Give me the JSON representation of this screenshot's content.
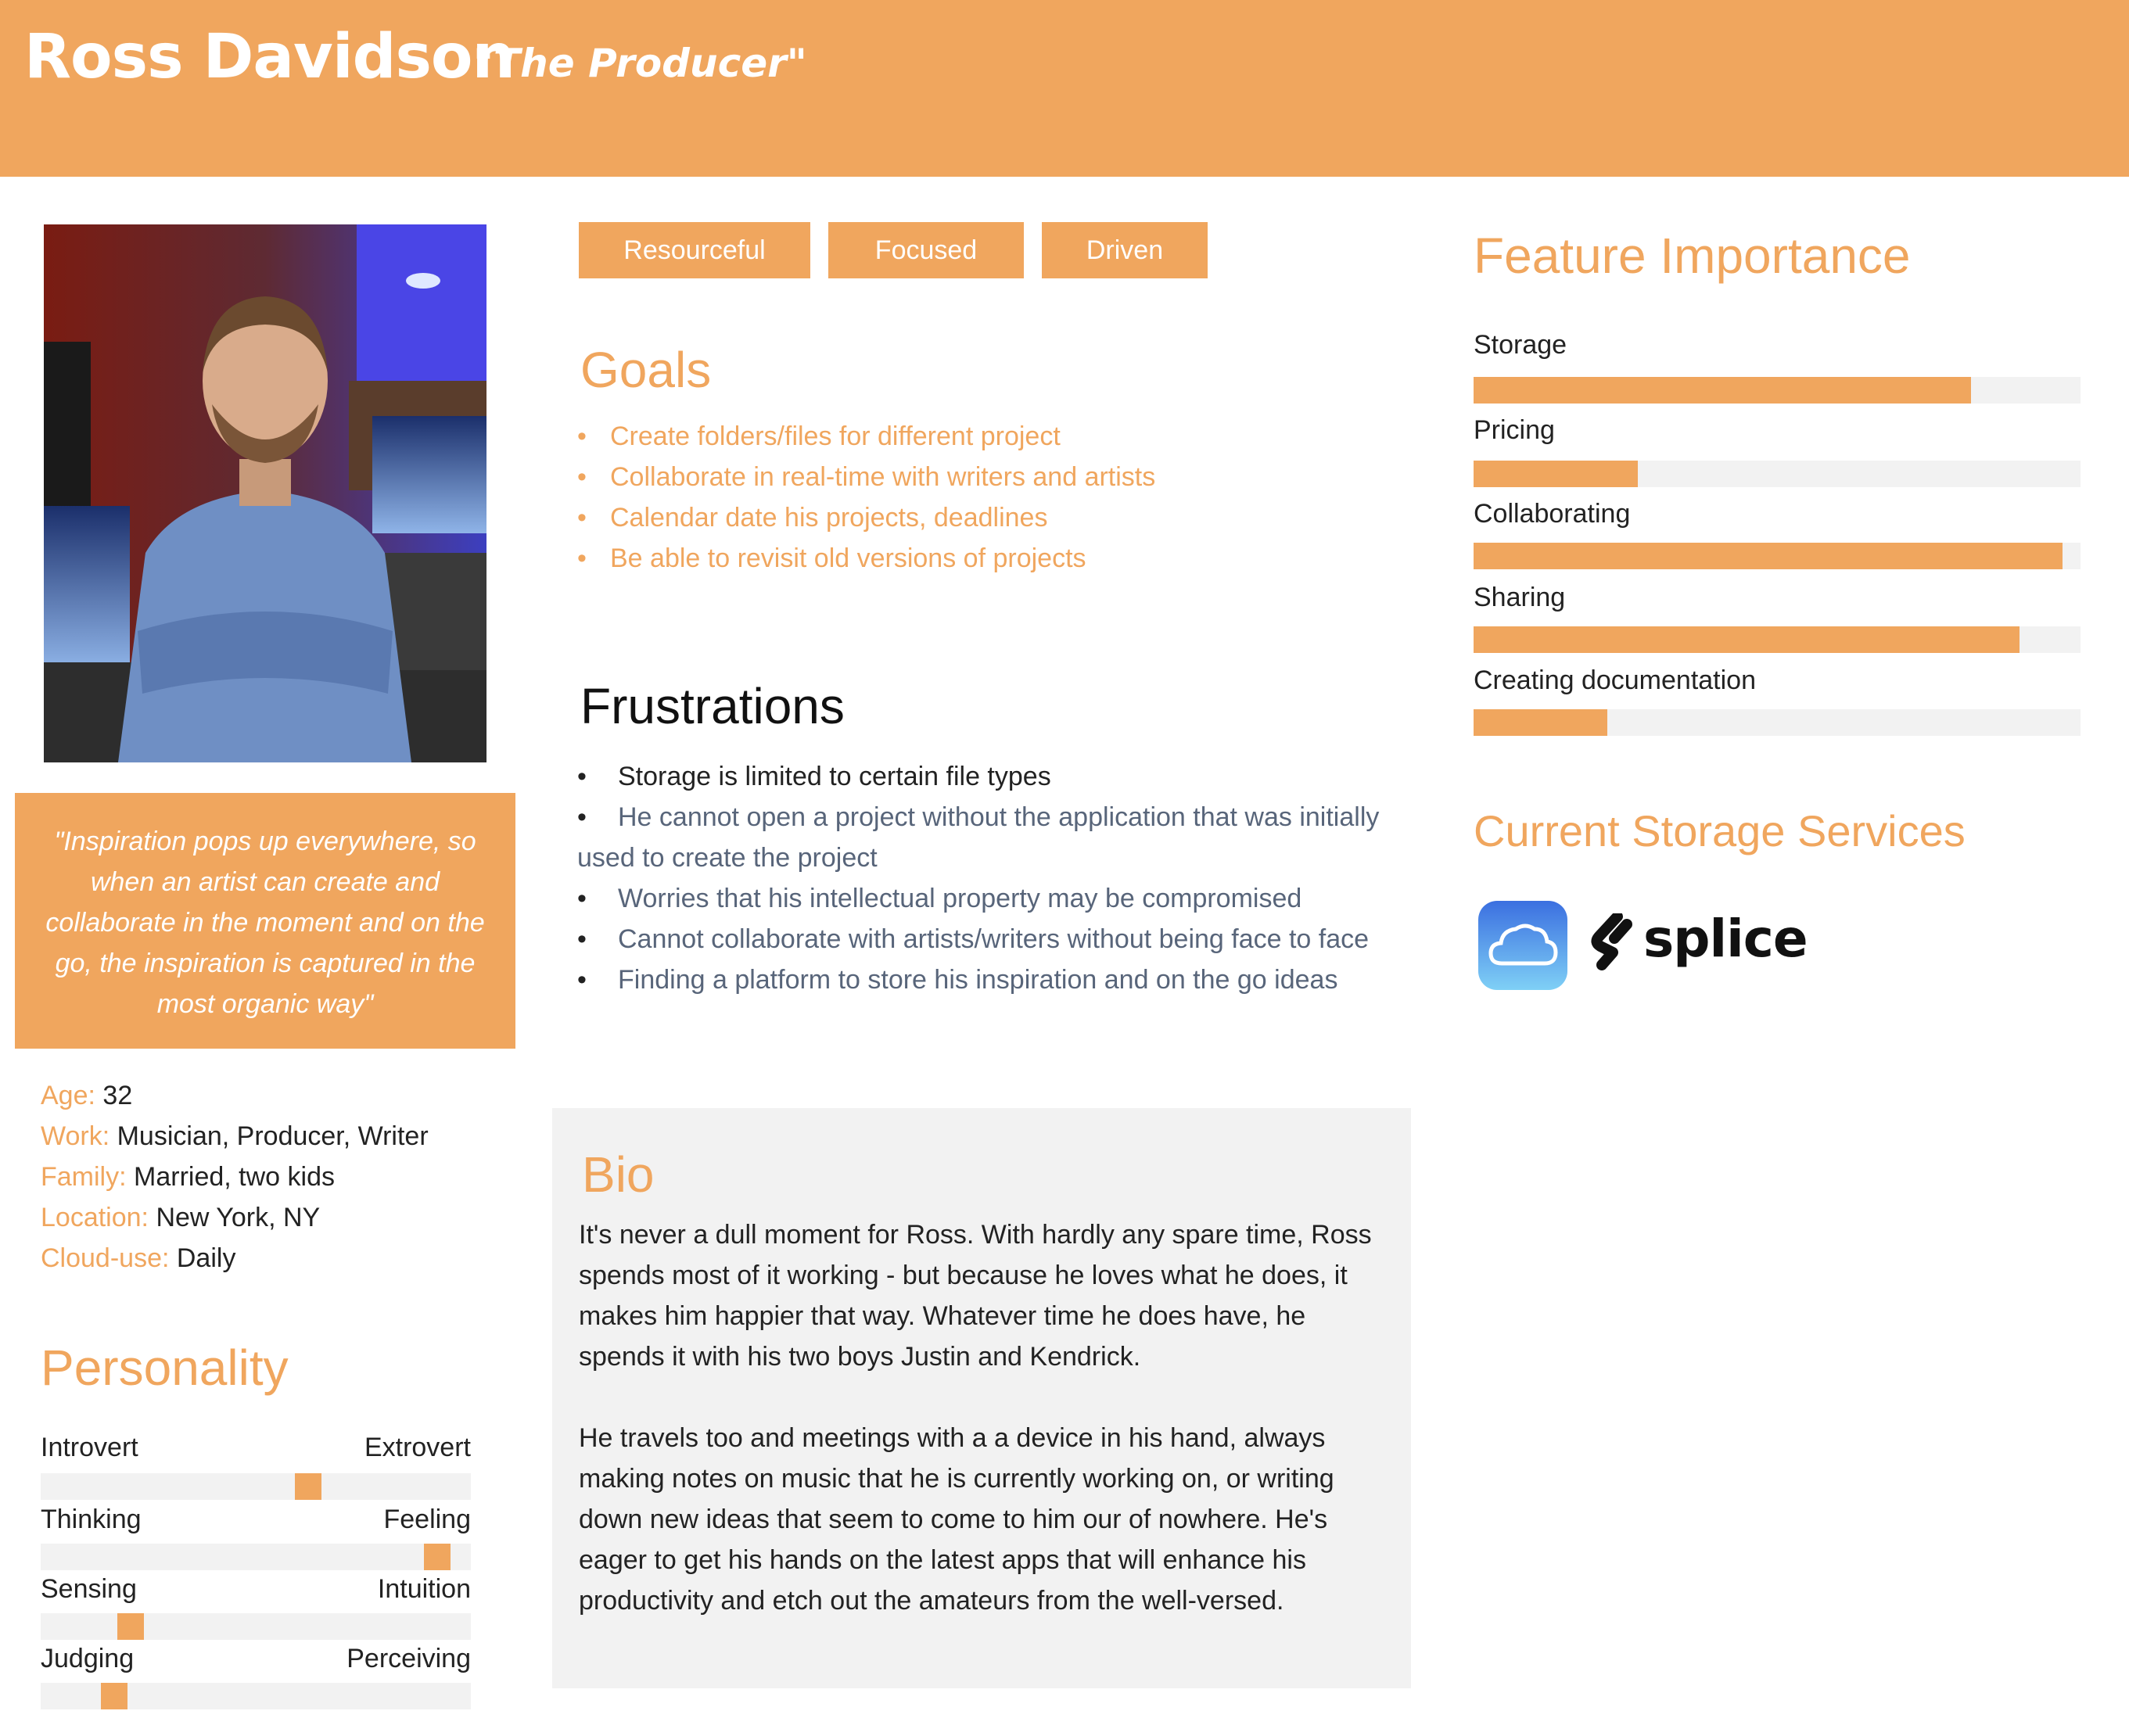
{
  "header": {
    "name": "Ross Davidson",
    "nickname": "\"The Producer\""
  },
  "quote": "\"Inspiration pops up everywhere, so when an artist can create and collaborate in the moment and on the go, the inspiration is captured in the most organic way\"",
  "facts": [
    {
      "label": "Age:",
      "value": "32"
    },
    {
      "label": "Work:",
      "value": "Musician, Producer, Writer"
    },
    {
      "label": "Family:",
      "value": "Married, two kids"
    },
    {
      "label": "Location:",
      "value": "New York, NY"
    },
    {
      "label": "Cloud-use:",
      "value": "Daily"
    }
  ],
  "personality": {
    "title": "Personality",
    "traits": [
      {
        "left": "Introvert",
        "right": "Extrovert",
        "level": 0.63
      },
      {
        "left": "Thinking",
        "right": "Feeling",
        "level": 0.95
      },
      {
        "left": "Sensing",
        "right": "Intuition",
        "level": 0.19
      },
      {
        "left": "Judging",
        "right": "Perceiving",
        "level": 0.15
      }
    ]
  },
  "tags": [
    "Resourceful",
    "Focused",
    "Driven"
  ],
  "goals": {
    "title": "Goals",
    "items": [
      "Create folders/files for different project",
      "Collaborate in real-time with writers and artists",
      "Calendar date his projects, deadlines",
      "Be able to revisit old versions of projects"
    ]
  },
  "frustrations": {
    "title": "Frustrations",
    "items": [
      "Storage is limited to certain file types",
      "He cannot open a project without the application that was initially used to create the project",
      "Worries that his intellectual property may be compromised",
      "Cannot collaborate with artists/writers without being face to face",
      "Finding a platform to store his inspiration and on the go ideas"
    ]
  },
  "bio": {
    "title": "Bio",
    "paragraphs": [
      "It's never a dull moment for Ross. With hardly any spare time, Ross spends most of it working - but because he loves what he does, it makes him happier that way. Whatever time he does have, he spends it with his two boys Justin and Kendrick.",
      "He travels too and meetings with a a device in his hand, always making notes on music that he is currently working on, or writing down new ideas that seem to come to him our of nowhere. He's eager to get his hands on the latest apps that will enhance his productivity and etch out the amateurs from the well-versed."
    ]
  },
  "features": {
    "title": "Feature Importance",
    "items": [
      {
        "label": "Storage",
        "level": 0.82
      },
      {
        "label": "Pricing",
        "level": 0.27
      },
      {
        "label": "Collaborating",
        "level": 0.97
      },
      {
        "label": "Sharing",
        "level": 0.9
      },
      {
        "label": "Creating documentation",
        "level": 0.22
      }
    ]
  },
  "storage_services": {
    "title": "Current Storage Services",
    "services": [
      {
        "name": "iCloud",
        "icon": "icloud-icon"
      },
      {
        "name": "splice",
        "icon": "splice-logo"
      }
    ]
  },
  "colors": {
    "accent": "#F0A65E",
    "track": "#F2F2F2",
    "bio_bg": "#F2F2F2"
  }
}
